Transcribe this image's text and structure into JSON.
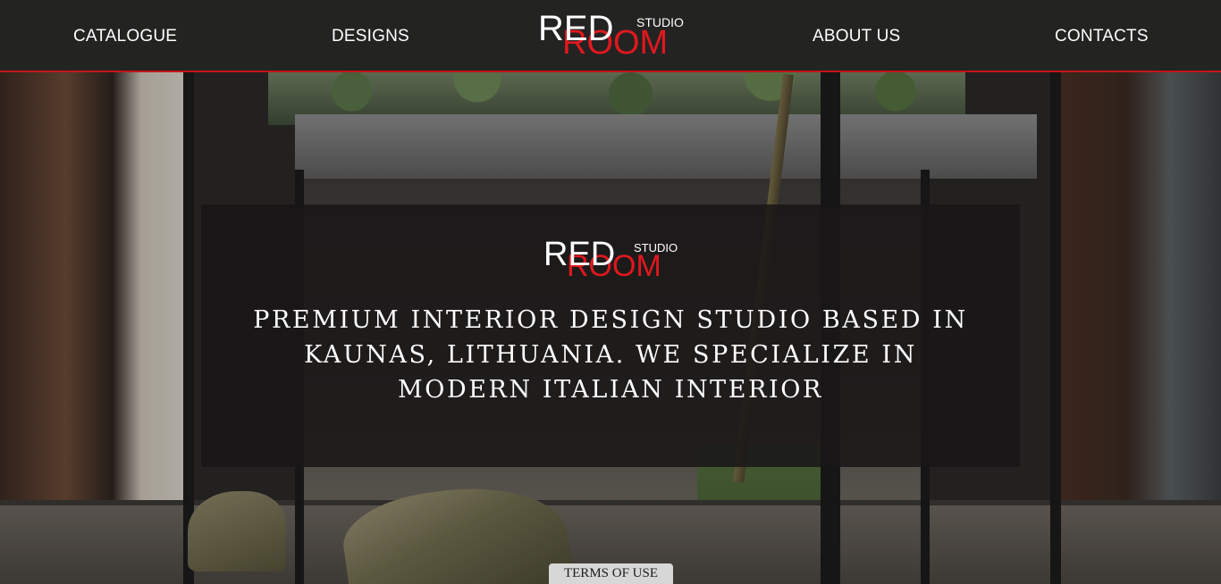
{
  "nav": {
    "catalogue": "CATALOGUE",
    "designs": "DESIGNS",
    "about": "ABOUT US",
    "contacts": "CONTACTS"
  },
  "logo": {
    "word1": "RED",
    "word2": "ROOM",
    "word3": "STUDIO"
  },
  "hero": {
    "tagline": "PREMIUM INTERIOR DESIGN STUDIO BASED IN KAUNAS, LITHUANIA. WE SPECIALIZE IN MODERN ITALIAN INTERIOR"
  },
  "footer": {
    "terms_label": "TERMS OF USE"
  },
  "colors": {
    "accent_red": "#e0181e",
    "header_bg": "#232322",
    "header_border": "#c4141a"
  }
}
